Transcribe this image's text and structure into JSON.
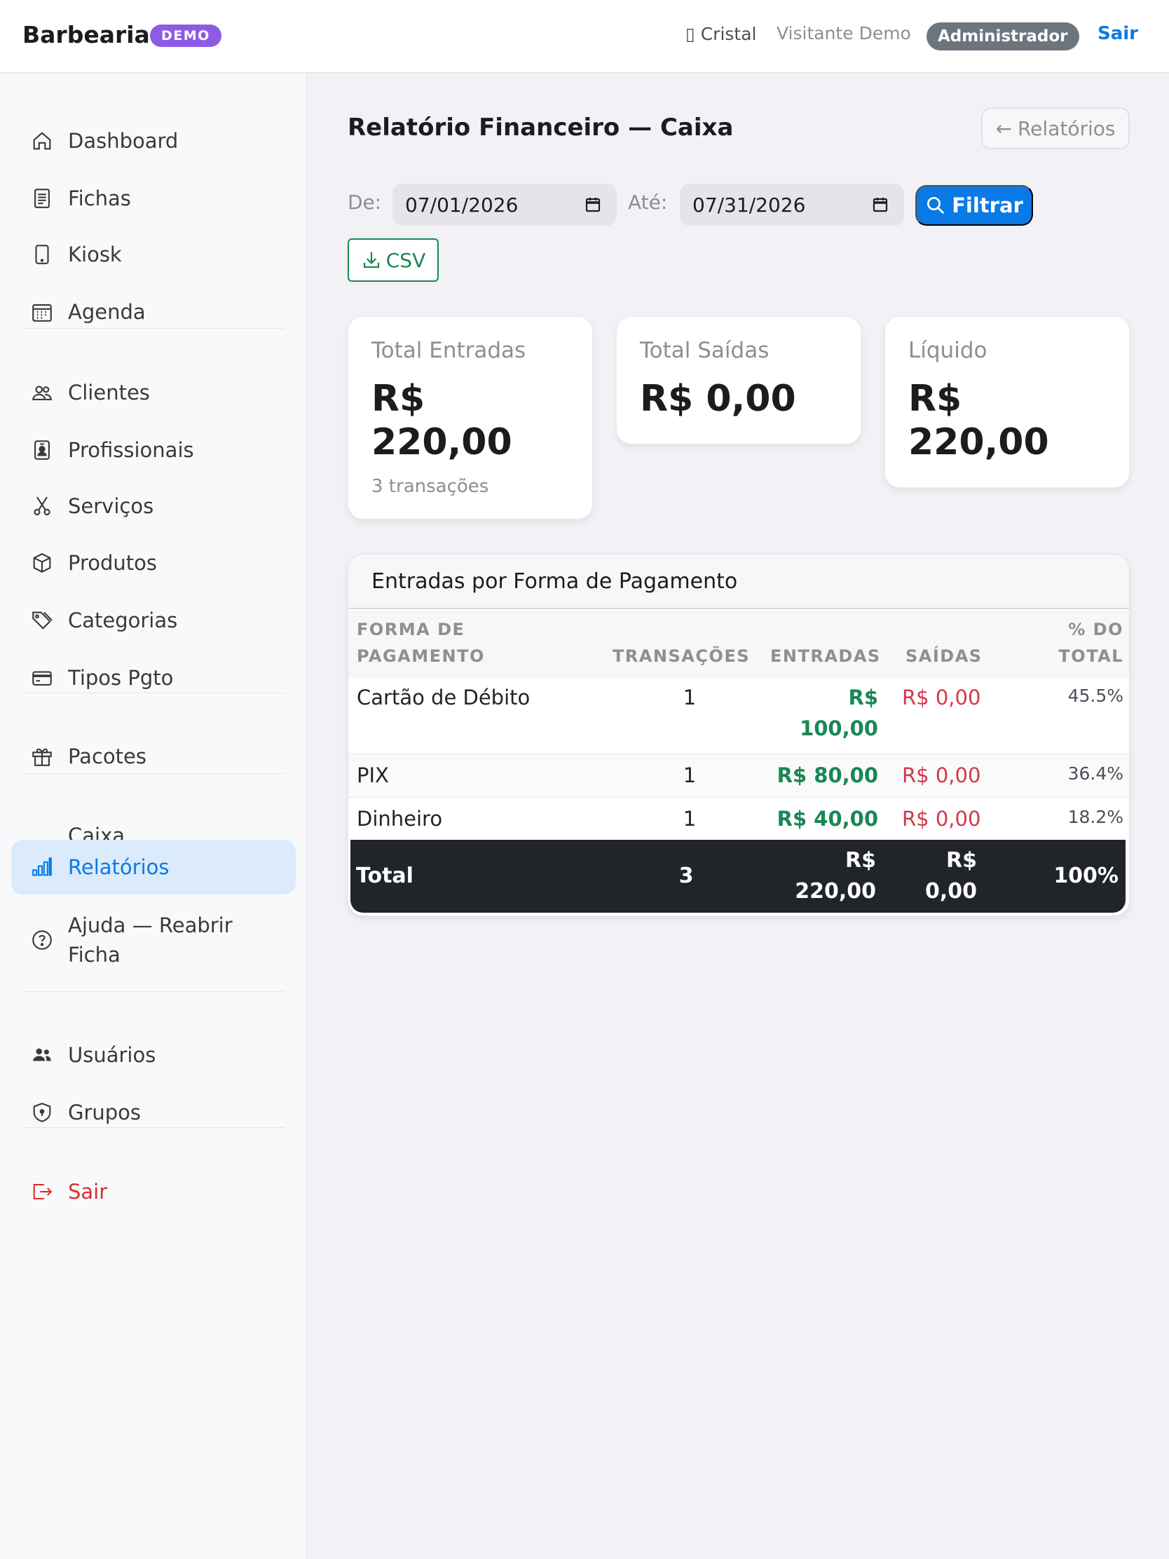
{
  "header": {
    "brand": "Barbearia",
    "demo_badge": "DEMO",
    "tenant": "▯ Cristal",
    "user": "Visitante Demo",
    "role": "Administrador",
    "logout": "Sair"
  },
  "sidebar": {
    "items": [
      {
        "label": "Dashboard",
        "icon": "home-icon"
      },
      {
        "label": "Fichas",
        "icon": "document-icon"
      },
      {
        "label": "Kiosk",
        "icon": "tablet-icon"
      },
      {
        "label": "Agenda",
        "icon": "calendar-icon"
      },
      {
        "label": "Clientes",
        "icon": "people-icon"
      },
      {
        "label": "Profissionais",
        "icon": "badge-icon"
      },
      {
        "label": "Serviços",
        "icon": "scissors-icon"
      },
      {
        "label": "Produtos",
        "icon": "box-icon"
      },
      {
        "label": "Categorias",
        "icon": "tags-icon"
      },
      {
        "label": "Tipos Pgto",
        "icon": "credit-card-icon"
      },
      {
        "label": "Pacotes",
        "icon": "gift-icon"
      },
      {
        "label": "Caixa",
        "icon": ""
      },
      {
        "label": "Relatórios",
        "icon": "bar-chart-icon",
        "active": true
      },
      {
        "label": "Ajuda — Reabrir Ficha",
        "icon": "question-circle-icon"
      },
      {
        "label": "Usuários",
        "icon": "people-fill-icon"
      },
      {
        "label": "Grupos",
        "icon": "shield-lock-icon"
      },
      {
        "label": "Sair",
        "icon": "logout-icon"
      }
    ]
  },
  "main": {
    "title": "Relatório Financeiro — Caixa",
    "back_button": "Relatórios",
    "filter": {
      "from_label": "De:",
      "from_value": "07/01/2026",
      "to_label": "Até:",
      "to_value": "07/31/2026",
      "filter_button": "Filtrar",
      "csv_button": "CSV"
    },
    "cards": [
      {
        "label": "Total Entradas",
        "value_line1": "R$",
        "value_line2": "220,00",
        "sub": "3 transações"
      },
      {
        "label": "Total Saídas",
        "value": "R$ 0,00"
      },
      {
        "label": "Líquido",
        "value_line1": "R$",
        "value_line2": "220,00"
      }
    ],
    "table": {
      "title": "Entradas por Forma de Pagamento",
      "columns": {
        "method_1": "FORMA DE",
        "method_2": "PAGAMENTO",
        "transactions": "TRANSAÇÕES",
        "entries": "ENTRADAS",
        "exits": "SAÍDAS",
        "pct_1": "% DO",
        "pct_2": "TOTAL"
      },
      "rows": [
        {
          "method": "Cartão de Débito",
          "transactions": "1",
          "entries_1": "R$",
          "entries_2": "100,00",
          "exits": "R$ 0,00",
          "pct": "45.5%"
        },
        {
          "method": "PIX",
          "transactions": "1",
          "entries": "R$ 80,00",
          "exits": "R$ 0,00",
          "pct": "36.4%"
        },
        {
          "method": "Dinheiro",
          "transactions": "1",
          "entries": "R$ 40,00",
          "exits": "R$ 0,00",
          "pct": "18.2%"
        }
      ],
      "total": {
        "label": "Total",
        "transactions": "3",
        "entries_1": "R$",
        "entries_2": "220,00",
        "exits_1": "R$",
        "exits_2": "0,00",
        "pct": "100%"
      }
    }
  },
  "colors": {
    "accent": "#0a7ae6",
    "demo_badge": "#8c5ce6",
    "positive": "#198754",
    "negative": "#d1394a",
    "danger": "#d93030"
  }
}
